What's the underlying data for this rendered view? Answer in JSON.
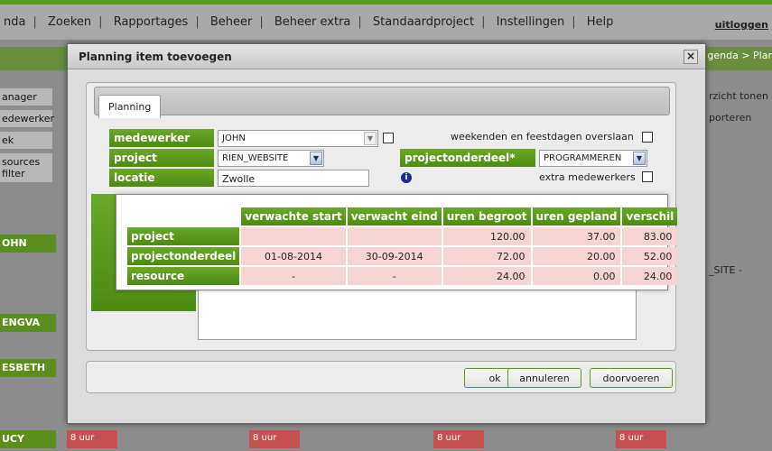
{
  "menu": {
    "items": [
      "nda",
      "Zoeken",
      "Rapportages",
      "Beheer",
      "Beheer extra",
      "Standaardproject",
      "Instellingen",
      "Help"
    ],
    "logout": "uitloggen"
  },
  "background": {
    "breadcrumb": "genda > Plar",
    "left_labels": [
      "anager",
      "edewerker",
      "ek",
      "sources filter"
    ],
    "people": [
      "OHN",
      "ENGVA",
      "ESBETH",
      "UCY"
    ],
    "right_buttons": [
      "rzicht tonen",
      "porteren"
    ],
    "right_text": "_SITE -",
    "hours_label": "8 uur"
  },
  "modal": {
    "title": "Planning item toevoegen",
    "close": "×",
    "tab": "Planning",
    "fields": {
      "medewerker_label": "medewerker",
      "medewerker_value": "JOHN",
      "project_label": "project",
      "project_value": "RIEN_WEBSITE",
      "locatie_label": "locatie",
      "locatie_value": "Zwolle",
      "projectonderdeel_label": "projectonderdeel*",
      "projectonderdeel_value": "PROGRAMMEREN",
      "weekenden_label": "weekenden en feestdagen overslaan",
      "extra_label": "extra medewerkers",
      "info": "i"
    },
    "summary": {
      "headers": [
        "verwachte start",
        "verwacht eind",
        "uren begroot",
        "uren gepland",
        "verschil"
      ],
      "rows": [
        {
          "label": "project",
          "values": [
            "",
            "",
            "120.00",
            "37.00",
            "83.00"
          ]
        },
        {
          "label": "projectonderdeel",
          "values": [
            "01-08-2014",
            "30-09-2014",
            "72.00",
            "20.00",
            "52.00"
          ]
        },
        {
          "label": "resource",
          "values": [
            "-",
            "-",
            "24.00",
            "0.00",
            "24.00"
          ]
        }
      ]
    },
    "buttons": {
      "ok": "ok",
      "cancel": "annuleren",
      "apply": "doorvoeren"
    }
  }
}
